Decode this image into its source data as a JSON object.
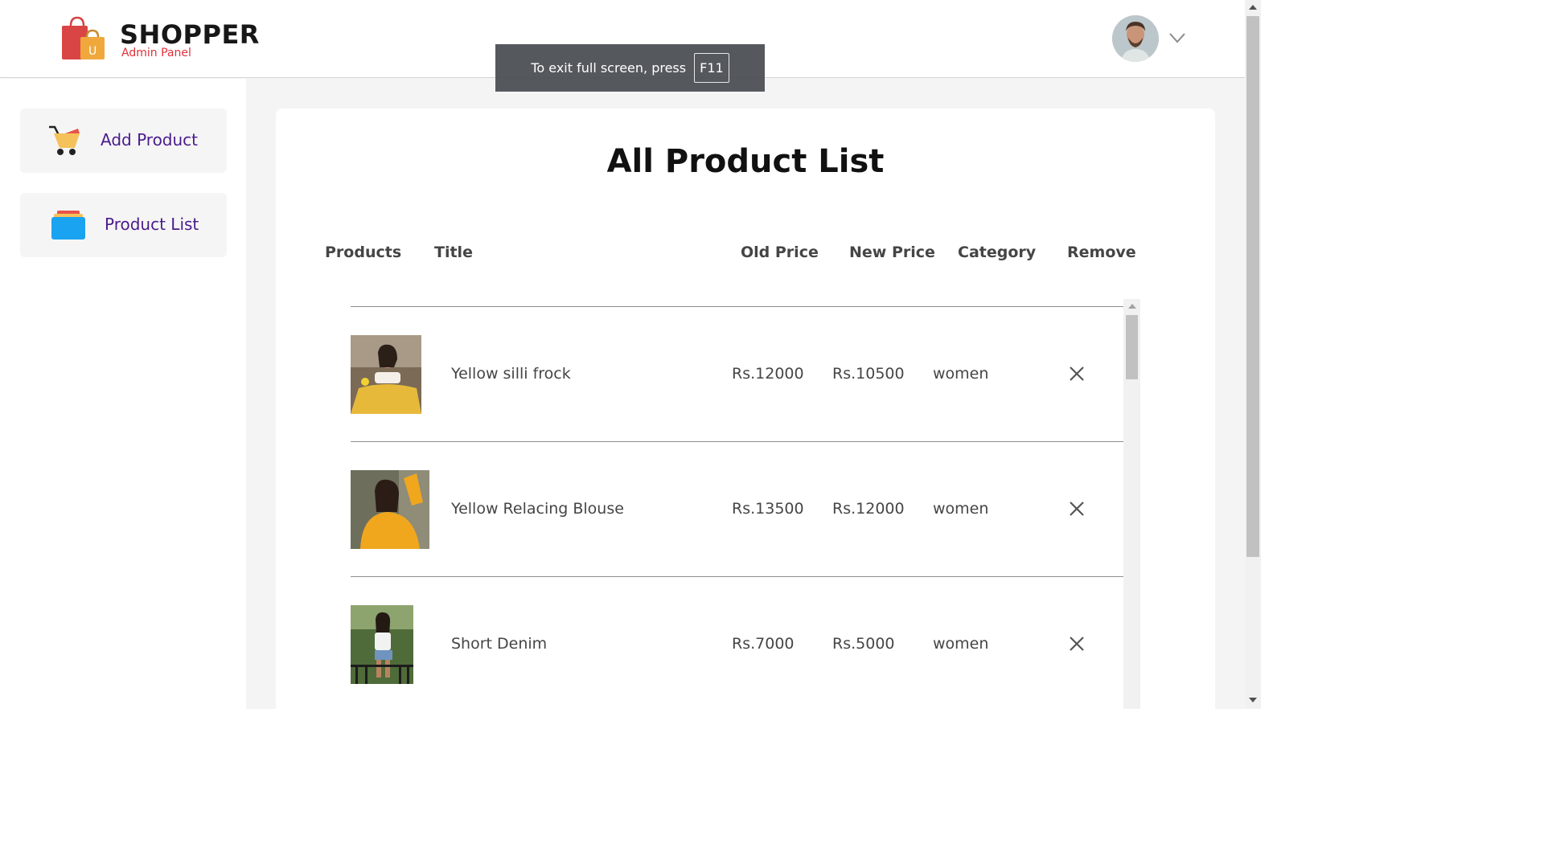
{
  "navbar": {
    "brand": "SHOPPER",
    "subtitle": "Admin Panel",
    "logo_icon": "shopping-bag-logo",
    "avatar_icon": "user-avatar",
    "dropdown_icon": "chevron-down-icon"
  },
  "fullscreen_toast": {
    "message": "To exit full screen, press",
    "key": "F11"
  },
  "sidebar": {
    "items": [
      {
        "label": "Add Product",
        "icon": "cart-icon"
      },
      {
        "label": "Product List",
        "icon": "list-stack-icon"
      }
    ]
  },
  "main": {
    "title": "All Product List",
    "columns": [
      "Products",
      "Title",
      "Old Price",
      "New Price",
      "Category",
      "Remove"
    ],
    "rows": [
      {
        "image": "product-thumbnail",
        "title": "Yellow silli frock",
        "old_price": "Rs.12000",
        "new_price": "Rs.10500",
        "category": "women",
        "remove_icon": "close-icon"
      },
      {
        "image": "product-thumbnail",
        "title": "Yellow Relacing Blouse",
        "old_price": "Rs.13500",
        "new_price": "Rs.12000",
        "category": "women",
        "remove_icon": "close-icon"
      },
      {
        "image": "product-thumbnail",
        "title": "Short Denim",
        "old_price": "Rs.7000",
        "new_price": "Rs.5000",
        "category": "women",
        "remove_icon": "close-icon"
      }
    ]
  },
  "colors": {
    "brand_red": "#e0303a",
    "nav_purple": "#4a1b8c",
    "sidebar_bg": "#f5f5f5",
    "main_bg": "#f4f4f4"
  }
}
